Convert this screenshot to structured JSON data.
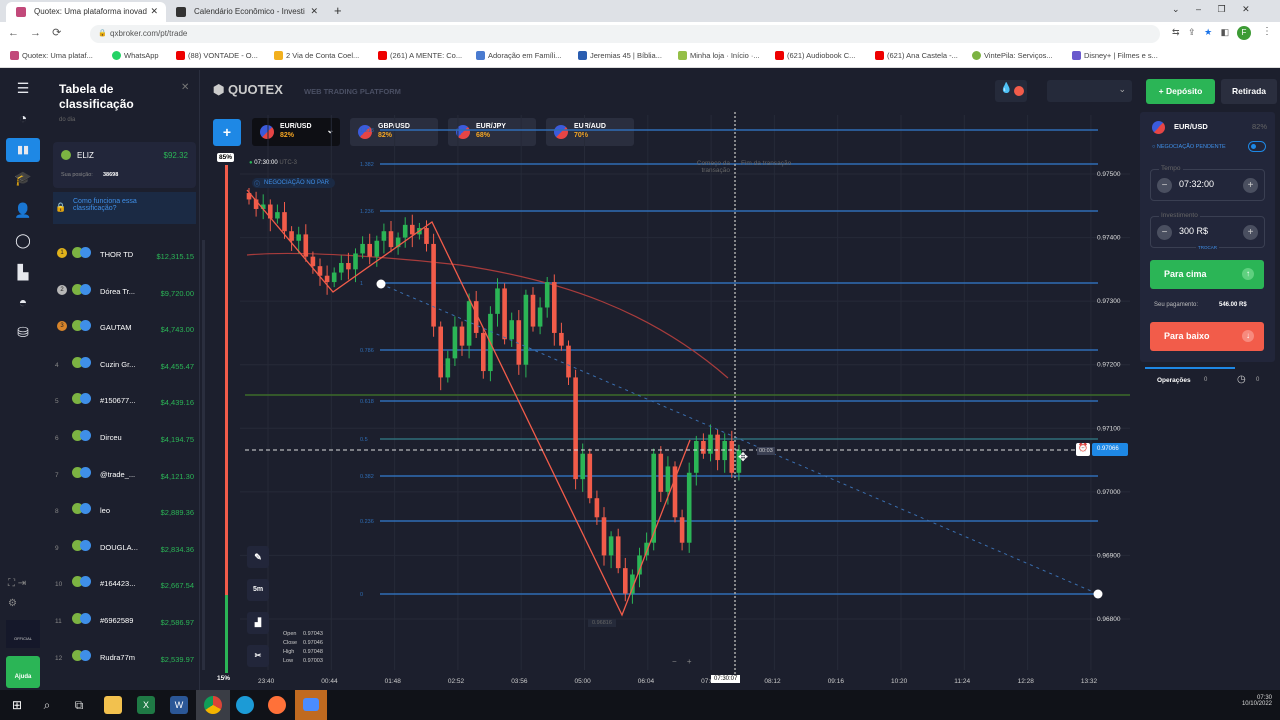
{
  "browser": {
    "tabs": [
      {
        "title": "Quotex: Uma plataforma inovad"
      },
      {
        "title": "Calendário Econômico - Investi"
      }
    ],
    "url": "qxbroker.com/pt/trade",
    "bookmarks": [
      "Quotex: Uma plataf...",
      "WhatsApp",
      "(88) VONTADE - O...",
      "2 Via de Conta Coel...",
      "(261) A MENTE: Co...",
      "Adoração em Famíli...",
      "Jeremias 45 | Bíblia...",
      "Minha loja · Início ·...",
      "(621) Audiobook C...",
      "(621) Ana Castela -...",
      "VintePila: Serviços...",
      "Disney+ | Filmes e s..."
    ],
    "profile_initial": "F"
  },
  "leaderboard": {
    "title": "Tabela de classificação",
    "subtitle": "do dia",
    "me": {
      "name": "ELIZ",
      "amount": "$92.32",
      "position_label": "Sua posição:",
      "position": "38698"
    },
    "help_link": "Como funciona essa classificação?",
    "rows": [
      {
        "rank": "1",
        "name": "THOR TD",
        "amount": "$12,315.15"
      },
      {
        "rank": "2",
        "name": "Dórea Tr...",
        "amount": "$9,720.00"
      },
      {
        "rank": "3",
        "name": "GAUTAM",
        "amount": "$4,743.00"
      },
      {
        "rank": "4",
        "name": "Cuzin Gr...",
        "amount": "$4,455.47"
      },
      {
        "rank": "5",
        "name": "#150677...",
        "amount": "$4,439.16"
      },
      {
        "rank": "6",
        "name": "Dirceu",
        "amount": "$4,194.75"
      },
      {
        "rank": "7",
        "name": "@trade_...",
        "amount": "$4,121.30"
      },
      {
        "rank": "8",
        "name": "leo",
        "amount": "$2,889.36"
      },
      {
        "rank": "9",
        "name": "DOUGLA...",
        "amount": "$2,834.36"
      },
      {
        "rank": "10",
        "name": "#164423...",
        "amount": "$2,667.54"
      },
      {
        "rank": "11",
        "name": "#6962589",
        "amount": "$2,586.97"
      },
      {
        "rank": "12",
        "name": "Rudra77m",
        "amount": "$2,539.97"
      }
    ]
  },
  "rail": {
    "help_label": "Ajuda",
    "official_label": "OFFICIAL"
  },
  "header": {
    "logo": "QUOTEX",
    "tagline": "WEB TRADING PLATFORM"
  },
  "assets": [
    {
      "name": "EUR/USD",
      "pct": "82%"
    },
    {
      "name": "GBP/USD",
      "pct": "82%"
    },
    {
      "name": "EUR/JPY",
      "pct": "68%"
    },
    {
      "name": "EUR/AUD",
      "pct": "70%"
    }
  ],
  "chart": {
    "sentiment_top": "85%",
    "sentiment_bottom": "15%",
    "timer": "07:30:00",
    "timer_suffix": "UTC-3",
    "pending_label": "NEGOCIAÇÃO NO PAR",
    "start_label": "Começo da transação",
    "end_label": "Fim da transação",
    "timeframe": "5m",
    "current_price": "0.97066",
    "countdown": "00:03",
    "cursor_time": "07:30:07",
    "low_label": "0.96816",
    "ohlc": {
      "open_label": "Open",
      "open": "0.97043",
      "close_label": "Close",
      "close": "0.97046",
      "high_label": "High",
      "high": "0.97048",
      "low_label": "Low",
      "low": "0.97003"
    },
    "price_ticks": [
      "0.97500",
      "0.97400",
      "0.97300",
      "0.97200",
      "0.97100",
      "0.97000",
      "0.96900",
      "0.96800"
    ],
    "time_ticks": [
      "23:40",
      "00:44",
      "01:48",
      "02:52",
      "03:56",
      "05:00",
      "06:04",
      "07:08",
      "08:12",
      "09:16",
      "10:20",
      "11:24",
      "12:28",
      "13:32"
    ],
    "fib_levels": [
      "1.618",
      "1.382",
      "1.236",
      "1",
      "0.786",
      "0.618",
      "0.5",
      "0.382",
      "0.236",
      "0"
    ],
    "closes": [
      0.9746,
      0.97445,
      0.97452,
      0.9743,
      0.9744,
      0.9741,
      0.97395,
      0.97405,
      0.9737,
      0.97355,
      0.9734,
      0.9733,
      0.97345,
      0.9736,
      0.9735,
      0.97375,
      0.9739,
      0.9737,
      0.97395,
      0.9741,
      0.97385,
      0.974,
      0.9742,
      0.97405,
      0.97415,
      0.9739,
      0.9726,
      0.9718,
      0.9721,
      0.9726,
      0.9723,
      0.973,
      0.9725,
      0.9719,
      0.9728,
      0.9732,
      0.9724,
      0.9727,
      0.972,
      0.9731,
      0.9726,
      0.9729,
      0.9733,
      0.9725,
      0.9723,
      0.9718,
      0.9702,
      0.9706,
      0.9699,
      0.9696,
      0.969,
      0.9693,
      0.9688,
      0.9684,
      0.9687,
      0.969,
      0.9692,
      0.9706,
      0.97,
      0.9704,
      0.9696,
      0.9692,
      0.9703,
      0.9708,
      0.9706,
      0.9709,
      0.9705,
      0.9708,
      0.9703,
      0.97066
    ]
  },
  "trade": {
    "deposit": "Depósito",
    "withdraw": "Retirada",
    "asset": "EUR/USD",
    "pct": "82%",
    "pending": "NEGOCIAÇÃO PENDENTE",
    "time_label": "Tempo",
    "time": "07:32:00",
    "invest_label": "Investimento",
    "invest": "300 R$",
    "switch": "TROCAR",
    "up": "Para cima",
    "payout_label": "Seu pagamento:",
    "payout": "546.00 R$",
    "down": "Para baixo",
    "operations": "Operações",
    "ops_count": "0",
    "hist_count": "0"
  },
  "taskbar": {
    "time": "07:30",
    "date": "10/10/2022"
  },
  "colors": {
    "green": "#2bb556",
    "red": "#f25c4a",
    "blue": "#1e88e5",
    "fib": "#2f6db5"
  }
}
